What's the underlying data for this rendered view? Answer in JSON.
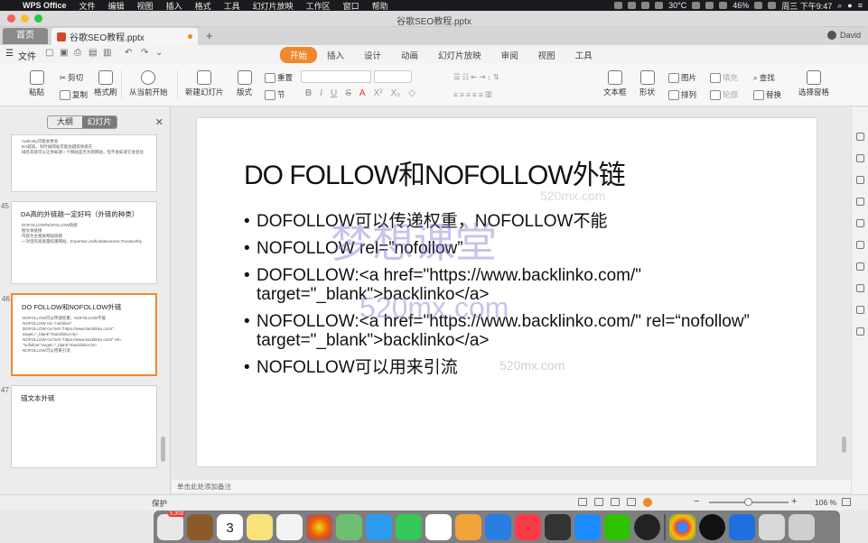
{
  "menubar": {
    "app_name": "WPS Office",
    "items": [
      "文件",
      "编辑",
      "视图",
      "插入",
      "格式",
      "工具",
      "幻灯片放映",
      "工作区",
      "窗口",
      "帮助"
    ],
    "status_temp": "30°C",
    "battery": "46%",
    "clock": "周三 下午9:47"
  },
  "titlebar": {
    "title": "谷歌SEO教程.pptx"
  },
  "tabbar": {
    "home": "首页",
    "doc_tab": "谷歌SEO教程.pptx",
    "user": "David"
  },
  "menurow": {
    "file": "文件",
    "tabs": [
      "开始",
      "插入",
      "设计",
      "动画",
      "幻灯片放映",
      "审阅",
      "视图",
      "工具"
    ],
    "active_tab": "开始"
  },
  "ribbon": {
    "paste": "粘贴",
    "cut": "剪切",
    "copy": "复制",
    "format_painter": "格式刷",
    "from_start": "从当前开始",
    "new_slide": "新建幻灯片",
    "layout": "版式",
    "reset": "重置",
    "section": "节",
    "text_box": "文本框",
    "shape": "形状",
    "picture": "图片",
    "arrange": "排列",
    "fill": "填充",
    "outline": "轮廓",
    "find": "查找",
    "replace": "替换",
    "selection_pane": "选择窗格",
    "format_buttons": [
      "B",
      "I",
      "U",
      "S",
      "A",
      "X²",
      "X₂"
    ]
  },
  "left_panel": {
    "tab_outline": "大纲",
    "tab_slides": "幻灯片",
    "thumbs": [
      {
        "num": "",
        "title": "",
        "lines": [
          "Authority可能会更高",
          "DA越高，有时候网站可能会越容易排在",
          "域名年龄可以让你知道一个网站是否为新网站，但不会知道它会变化"
        ]
      },
      {
        "num": "45",
        "title": "DA高的外链越一定好吗（外链的种类）",
        "lines": [
          "DOFOLLOW/NOFOLLOW链接",
          "图文本链接",
          "内容为主相关网站链接",
          "一对话的高质量权重网站，Expertise,Authoritativeness,Trustworthy"
        ]
      },
      {
        "num": "46",
        "title": "DO FOLLOW和NOFOLLOW外链",
        "lines": [
          "DOFOLLOW可以传递权重，NOFOLLOW不能",
          "NOFOLLOW rel=\"nofollow\"",
          "DOFOLLOW:<a href=\"https://www.backlinko.com/\"",
          "target=\"_blank\">backlinko</a>",
          "NOFOLLOW:<a href=\"https://www.backlinko.com/\" rel=",
          "\"nofollow\" target=\"_blank\">backlinko</a>",
          "NOFOLLOW可以用来引流"
        ]
      },
      {
        "num": "47",
        "title": "锚文本外链",
        "lines": []
      }
    ]
  },
  "slide": {
    "title": "DO FOLLOW和NOFOLLOW外链",
    "bullets": [
      "DOFOLLOW可以传递权重，NOFOLLOW不能",
      "NOFOLLOW rel=”nofollow”",
      "DOFOLLOW:<a href=\"https://www.backlinko.com/\" target=\"_blank\">backlinko</a>",
      "NOFOLLOW:<a href=\"https://www.backlinko.com/\" rel=“nofollow” target=\"_blank\">backlinko</a>",
      "NOFOLLOW可以用来引流"
    ],
    "watermark_cn": "梦想课堂",
    "watermark_domain": "520mx.com"
  },
  "notes": {
    "placeholder": "单击此处添加备注"
  },
  "statusbar": {
    "protect": "保护",
    "zoom": "106 %"
  },
  "dock": {
    "mail_badge": "5,303",
    "calendar_day": "3"
  },
  "colors": {
    "accent": "#f0882c",
    "ppt_orange": "#d24726"
  }
}
